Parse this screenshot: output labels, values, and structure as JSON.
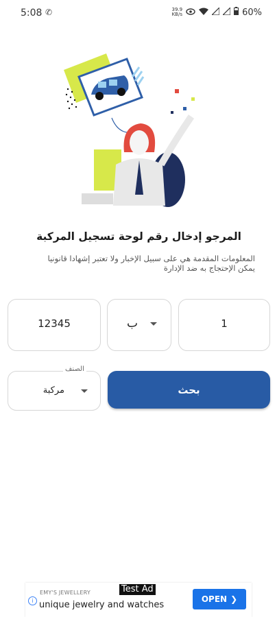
{
  "status_bar": {
    "time": "5:08",
    "speed_value": "39.9",
    "speed_unit": "KB/s",
    "battery": "60%"
  },
  "page": {
    "title": "المرجو إدخال رقم لوحة تسجيل المركبة",
    "description": "المعلومات المقدمة هي على سبيل الإخبار ولا تعتبر إشهادا قانونيا يمكن الإحتجاج به ضد الإدارة"
  },
  "plate": {
    "number": "12345",
    "letter": "ب",
    "code": "1"
  },
  "category": {
    "label": "الصنف",
    "value": "مركبة"
  },
  "search_button": {
    "label": "بحث"
  },
  "ad": {
    "brand": "EMY'S JEWELLERY",
    "tag": "Test Ad",
    "text": "unique jewelry and watches",
    "cta": "OPEN"
  },
  "colors": {
    "primary": "#285ba5",
    "ad_button": "#1a73e8"
  }
}
